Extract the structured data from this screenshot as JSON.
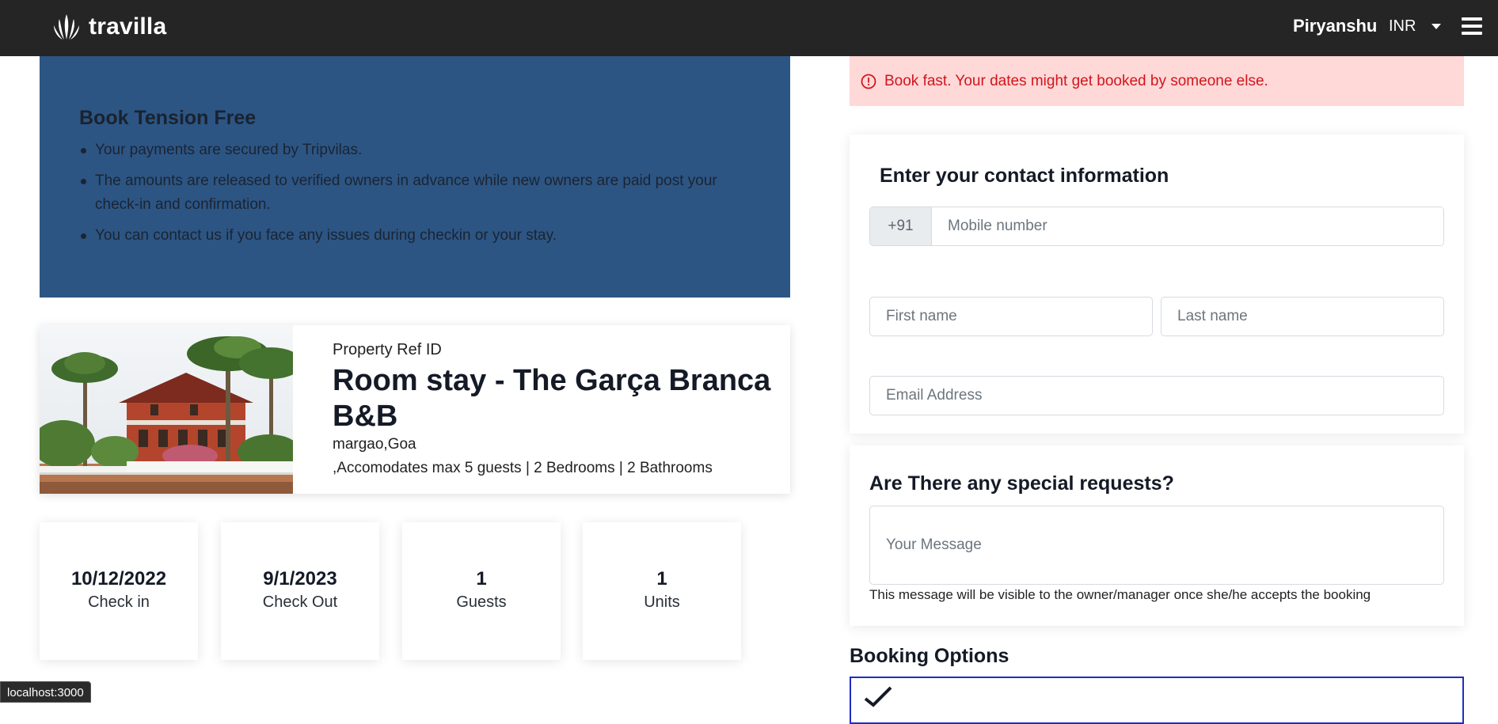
{
  "navbar": {
    "brand": "travilla",
    "user_name": "Piryanshu",
    "currency": "INR",
    "menu_icon": "hamburger-icon"
  },
  "tension": {
    "title": "Book Tension Free",
    "points": [
      "Your payments are secured by Tripvilas.",
      "The amounts are released to verified owners in advance while new owners are paid post your check-in and confirmation.",
      "You can contact us if you face any issues during checkin or your stay."
    ]
  },
  "property": {
    "ref_label": "Property Ref ID",
    "title": "Room stay - The Garça Branca B&B",
    "location": "margao,Goa",
    "details": ",Accomodates max 5 guests | 2 Bedrooms | 2 Bathrooms"
  },
  "stats": [
    {
      "value": "10/12/2022",
      "label": "Check in"
    },
    {
      "value": "9/1/2023",
      "label": "Check Out"
    },
    {
      "value": "1",
      "label": "Guests"
    },
    {
      "value": "1",
      "label": "Units"
    }
  ],
  "alert": {
    "icon": "info-icon",
    "text": "Book fast. Your dates might get booked by someone else."
  },
  "contact": {
    "title": "Enter your contact information",
    "phone_prefix": "+91",
    "phone_placeholder": "Mobile number",
    "first_name_placeholder": "First name",
    "last_name_placeholder": "Last name",
    "email_placeholder": "Email Address"
  },
  "requests": {
    "title": "Are There any special requests?",
    "message_placeholder": "Your Message",
    "hint": "This message will be visible to the owner/manager once she/he accepts the booking"
  },
  "booking": {
    "title": "Booking Options"
  },
  "status_bar": {
    "url": "localhost:3000"
  },
  "colors": {
    "navbar": "#252525",
    "tension_bg": "#2c5583",
    "alert_bg": "#ffd8d8",
    "alert_text": "#d0161c",
    "option_border": "#1e2ec0"
  }
}
